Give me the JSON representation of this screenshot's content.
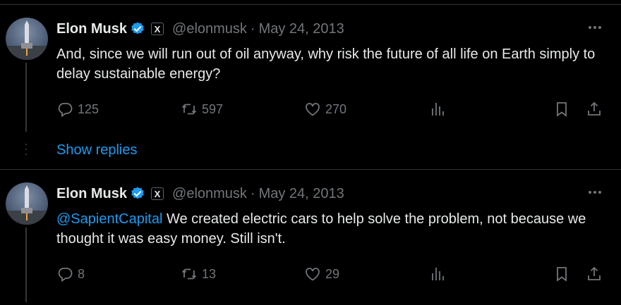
{
  "tweets": [
    {
      "author": "Elon Musk",
      "handle": "@elonmusk",
      "separator": "·",
      "date": "May 24, 2013",
      "affiliate_badge": "X",
      "mention": "",
      "text": "And, since we will run out of oil anyway, why risk the future of all life on Earth simply to delay sustainable energy?",
      "replies": "125",
      "retweets": "597",
      "likes": "270",
      "show_replies": "Show replies"
    },
    {
      "author": "Elon Musk",
      "handle": "@elonmusk",
      "separator": "·",
      "date": "May 24, 2013",
      "affiliate_badge": "X",
      "mention": "@SapientCapital",
      "text": " We created electric cars to help solve the problem, not because we thought it was easy money. Still isn't.",
      "replies": "8",
      "retweets": "13",
      "likes": "29"
    }
  ],
  "colors": {
    "background": "#000000",
    "text": "#e7e9ea",
    "muted": "#71767b",
    "accent": "#1d9bf0",
    "divider": "#2f3336"
  },
  "icons": [
    "verified-badge-icon",
    "more-icon",
    "reply-icon",
    "retweet-icon",
    "like-icon",
    "views-icon",
    "bookmark-icon",
    "share-icon"
  ]
}
